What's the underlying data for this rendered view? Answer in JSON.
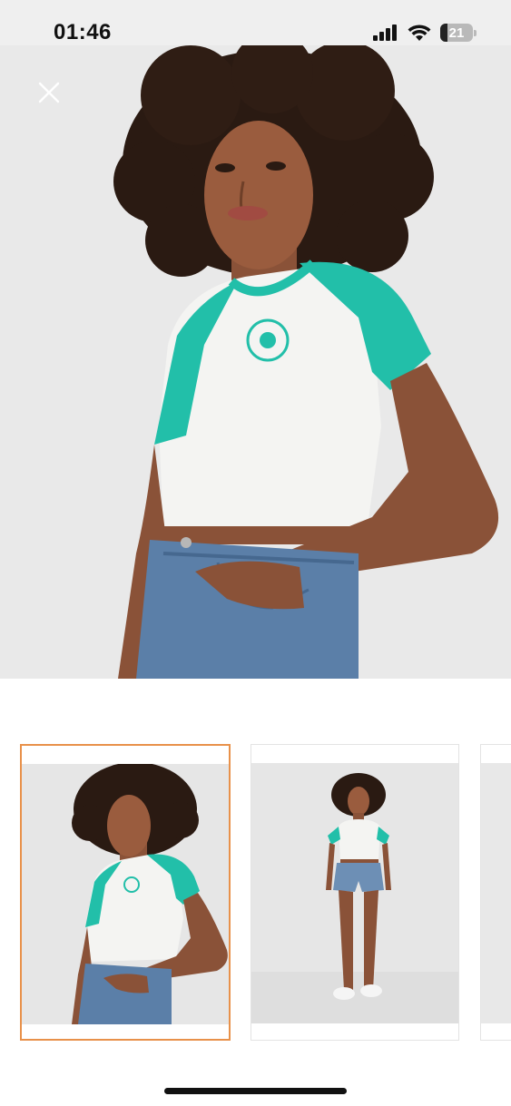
{
  "status_bar": {
    "time": "01:46",
    "battery_level": "21",
    "icons": [
      "signal-icon",
      "wifi-icon",
      "battery-icon"
    ]
  },
  "viewer": {
    "close_icon": "close-icon",
    "main_image": "model-white-teal-raglan-crop-top-closeup"
  },
  "thumbnails": [
    {
      "image": "model-closeup-thumbnail",
      "selected": true
    },
    {
      "image": "model-full-body-thumbnail",
      "selected": false
    },
    {
      "image": "partial-thumbnail",
      "selected": false
    }
  ],
  "colors": {
    "accent_border": "#e8914a",
    "shirt_teal": "#1fbfa8"
  }
}
